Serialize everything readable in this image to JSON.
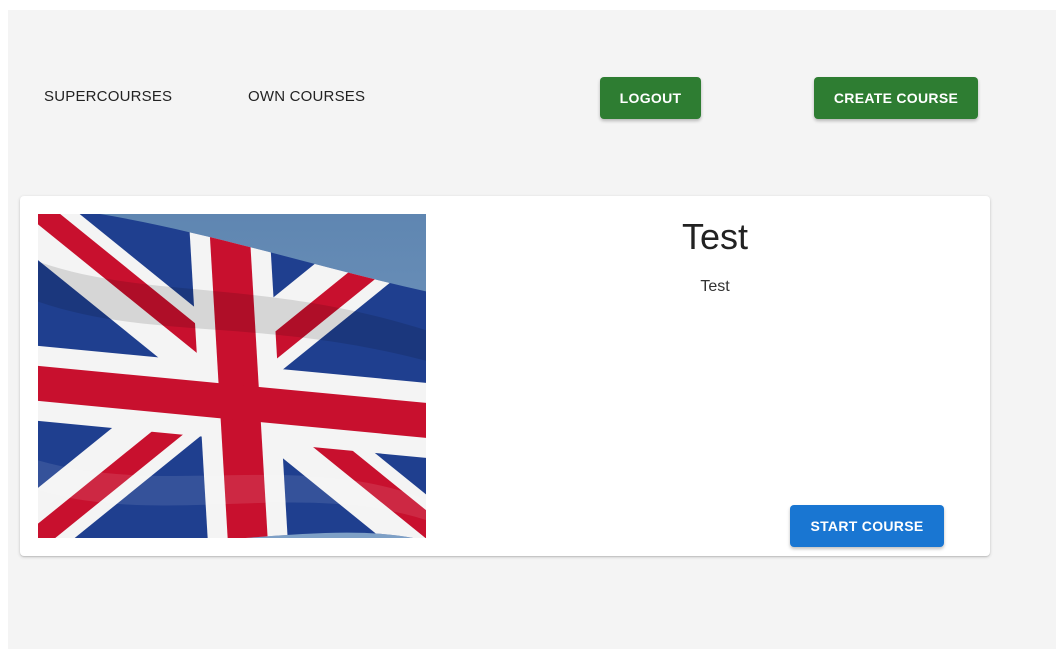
{
  "nav": {
    "supercourses_label": "SUPERCOURSES",
    "own_courses_label": "OWN COURSES",
    "logout_label": "LOGOUT",
    "create_course_label": "CREATE COURSE"
  },
  "course": {
    "title": "Test",
    "description": "Test",
    "start_label": "START COURSE",
    "image_icon": "union-jack-flag"
  },
  "colors": {
    "primary_green": "#2e7d32",
    "primary_blue": "#1976d2",
    "page_background": "#f4f4f4"
  }
}
